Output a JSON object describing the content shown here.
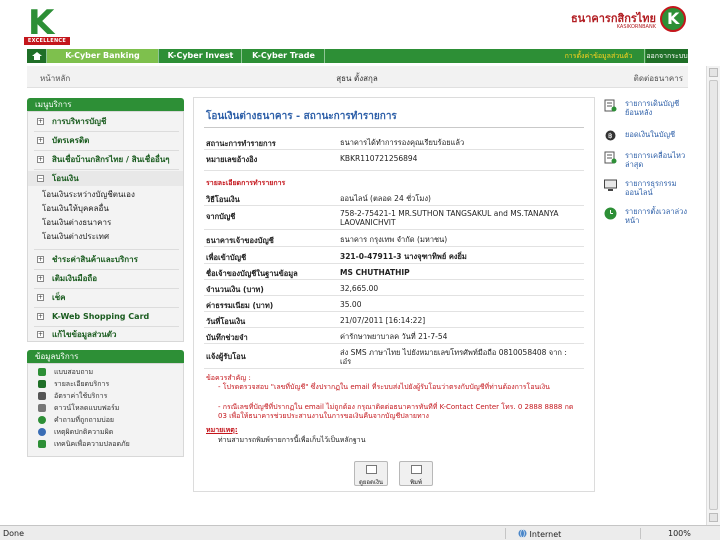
{
  "header": {
    "logo_letter": "K",
    "logo_tagline": "EXCELLENCE",
    "bank_name_th": "ธนาคารกสิกรไทย",
    "bank_name_en": "KASIKORNBANK"
  },
  "tabs": {
    "home": "",
    "active": "K-Cyber Banking",
    "invest": "K-Cyber Invest",
    "trade": "K-Cyber Trade",
    "edit_profile": "การตั้งค่าข้อมูลส่วนตัว",
    "logout": "ออกจากระบบ"
  },
  "subbar": {
    "home": "หน้าหลัก",
    "user": "สุธน ตั้งสกุล",
    "contact": "ติดต่อธนาคาร"
  },
  "menu": {
    "title": "เมนูบริการ",
    "items": [
      "การบริหารบัญชี",
      "บัตรเครดิต",
      "สินเชื่อบ้านกสิกรไทย / สินเชื่ออื่นๆ",
      "โอนเงิน",
      "ชำระค่าสินค้าและบริการ",
      "เติมเงินมือถือ",
      "เช็ค",
      "K-Web Shopping Card",
      "แก้ไขข้อมูลส่วนตัว"
    ],
    "sub_items": [
      "โอนเงินระหว่างบัญชีตนเอง",
      "โอนเงินให้บุคคลอื่น",
      "โอนเงินต่างธนาคาร",
      "โอนเงินต่างประเทศ"
    ]
  },
  "info": {
    "title": "ข้อมูลบริการ",
    "items": [
      "แบบสอบถาม",
      "รายละเอียดบริการ",
      "อัตราค่าใช้บริการ",
      "ดาวน์โหลดแบบฟอร์ม",
      "คำถามที่ถูกถามบ่อย",
      "เหตุผิดปกติความผิด",
      "เทคนิคเพื่อความปลอดภัย"
    ]
  },
  "panel": {
    "title": "โอนเงินต่างธนาคาร - สถานะการทำรายการ",
    "status_label": "สถานะการทำรายการ",
    "status_value": "ธนาคารได้ทำการรองคุณเรียบร้อยแล้ว",
    "ref_label": "หมายเลขอ้างอิง",
    "ref_value": "KBKR110721256894",
    "section_title": "รายละเอียดการทำรายการ",
    "rows": [
      {
        "label": "วิธีโอนเงิน",
        "value": "ออนไลน์ (ตลอด 24 ชั่วโมง)"
      },
      {
        "label": "จากบัญชี",
        "value": "758-2-75421-1 MR.SUTHON TANGSAKUL and MS.TANANYA LAOVANICHVIT"
      },
      {
        "label": "ธนาคารเจ้าของบัญชี",
        "value": "ธนาคาร กรุงเทพ จำกัด (มหาชน)"
      },
      {
        "label": "เพื่อเข้าบัญชี",
        "value": "321-0-47911-3 นางจุฑาทิพย์ คงยิ่ม"
      },
      {
        "label": "ชื่อเจ้าของบัญชีในฐานข้อมูล",
        "value": "MS CHUTHATHIP"
      },
      {
        "label": "จำนวนเงิน (บาท)",
        "value": "32,665.00"
      },
      {
        "label": "ค่าธรรมเนียม (บาท)",
        "value": "35.00"
      },
      {
        "label": "วันที่โอนเงิน",
        "value": "21/07/2011 [16:14:22]"
      },
      {
        "label": "บันทึกช่วยจำ",
        "value": "ค่ารักษาพยาบาลค วันที่ 21-7-54"
      },
      {
        "label": "แจ้งผู้รับโอน",
        "value": "ส่ง SMS ภาษาไทย ไปยังหมายเลขโทรศัพท์มือถือ 0810058408 จาก : เอ๋ร"
      }
    ],
    "note_title": "ข้อควรสำคัญ :",
    "note_1": "- โปรดตรวจสอบ \"เลขที่บัญชี\" ซึ่งปรากฏใน email ที่ระบบส่งไปยังผู้รับโอนว่าตรงกับบัญชีที่ท่านต้องการโอนเงิน",
    "note_2": "- กรณีเลขที่บัญชีที่ปรากฏใน email ไม่ถูกต้อง กรุณาติดต่อธนาคารทันทีที่ K-Contact Center โทร. 0 2888 8888 กด 03 เพื่อให้ธนาคารช่วยประสานงานในการขอเงินคืนจากบัญชีปลายทาง",
    "remark_title": "หมายเหตุ:",
    "remark_text": "ท่านสามารถพิมพ์รายการนี้เพื่อเก็บไว้เป็นหลักฐาน",
    "btn_view": "ดูยอดเงิน",
    "btn_print": "พิมพ์"
  },
  "tools": [
    "รายการเดินบัญชีย้อนหลัง",
    "ยอดเงินในบัญชี",
    "รายการเคลื่อนไหวล่าสุด",
    "รายการธุรกรรมออนไลน์",
    "รายการตั้งเวลาล่วงหน้า"
  ],
  "statusbar": {
    "done": "Done",
    "zone": "Internet",
    "zoom": "100%"
  }
}
